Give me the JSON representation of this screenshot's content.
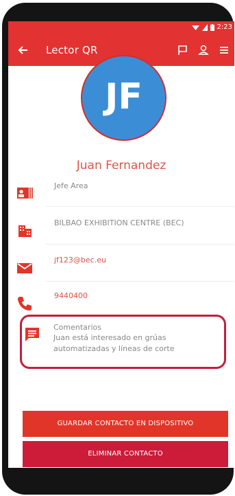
{
  "status_bar": {
    "time": "2:23"
  },
  "app_bar": {
    "title": "Lector QR"
  },
  "contact": {
    "initials": "JF",
    "name": "Juan Fernandez",
    "position": "Jefe Area",
    "company": "BILBAO EXHIBITION CENTRE (BEC)",
    "email": "jf123@bec.eu",
    "phone": "9440400",
    "comments_label": "Comentarios",
    "comments_text": "Juan está interesado en grúas automatizadas y líneas de corte"
  },
  "actions": {
    "save_label": "GUARDAR CONTACTO EN DISPOSITIVO",
    "delete_label": "ELIMINAR CONTACTO"
  },
  "colors": {
    "primary": "#e23232",
    "avatar": "#3b8ed6",
    "accent_text": "#e0524a",
    "delete_button": "#cc1c3a"
  },
  "icons": [
    "back-arrow-icon",
    "flag-icon",
    "person-icon",
    "menu-icon",
    "id-card-icon",
    "building-icon",
    "email-icon",
    "phone-icon",
    "comment-icon",
    "wifi-icon",
    "signal-icon",
    "battery-icon"
  ]
}
